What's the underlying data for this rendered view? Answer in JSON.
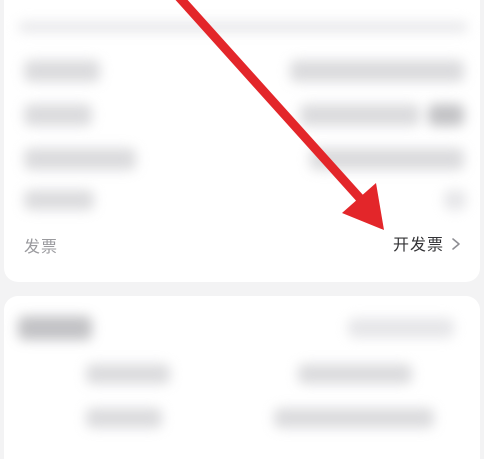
{
  "invoice_row": {
    "label": "发票",
    "action_label": "开发票",
    "chevron_icon": "chevron-right-icon"
  },
  "annotation": {
    "arrow_color": "#e3262a"
  }
}
